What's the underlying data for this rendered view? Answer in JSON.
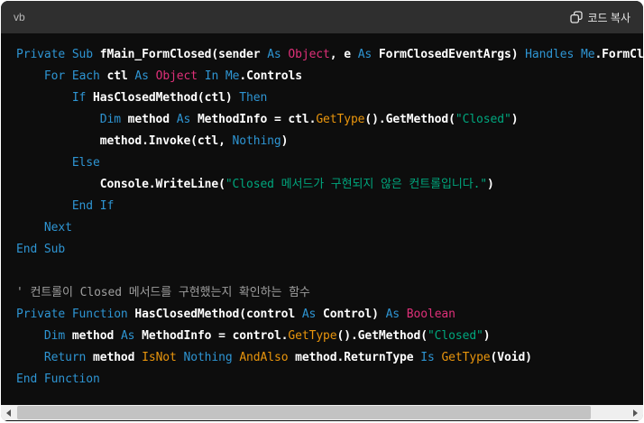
{
  "header": {
    "language": "vb",
    "copy_label": "코드 복사",
    "copy_icon": "copy-icon",
    "background": "#2f2f2f"
  },
  "colors": {
    "k": "#2e95d3",
    "t": "#df3079",
    "s": "#00a67d",
    "o": "#e9950c",
    "c": "#9e9e9e",
    "p": "#ffffff",
    "code_background": "#0d0d0d",
    "page_background": "#ffffff",
    "scrollbar_track": "#efefef",
    "scrollbar_thumb": "#c3c3c3"
  },
  "ui": {
    "icons": {
      "copy": "copy-icon",
      "scroll_left": "triangle-left-icon",
      "scroll_right": "triangle-right-icon"
    }
  },
  "code": {
    "lines": [
      {
        "tokens": [
          [
            "k",
            "Private"
          ],
          [
            "p",
            " "
          ],
          [
            "k",
            "Sub"
          ],
          [
            "p",
            " fMain_FormClosed(sender "
          ],
          [
            "k",
            "As"
          ],
          [
            "p",
            " "
          ],
          [
            "t",
            "Object"
          ],
          [
            "p",
            ", e "
          ],
          [
            "k",
            "As"
          ],
          [
            "p",
            " FormClosedEventArgs) "
          ],
          [
            "k",
            "Handles"
          ],
          [
            "p",
            " "
          ],
          [
            "k",
            "Me"
          ],
          [
            "p",
            ".FormClosed"
          ]
        ]
      },
      {
        "tokens": [
          [
            "p",
            "    "
          ],
          [
            "k",
            "For"
          ],
          [
            "p",
            " "
          ],
          [
            "k",
            "Each"
          ],
          [
            "p",
            " ctl "
          ],
          [
            "k",
            "As"
          ],
          [
            "p",
            " "
          ],
          [
            "t",
            "Object"
          ],
          [
            "p",
            " "
          ],
          [
            "k",
            "In"
          ],
          [
            "p",
            " "
          ],
          [
            "k",
            "Me"
          ],
          [
            "p",
            ".Controls"
          ]
        ]
      },
      {
        "tokens": [
          [
            "p",
            "        "
          ],
          [
            "k",
            "If"
          ],
          [
            "p",
            " HasClosedMethod(ctl) "
          ],
          [
            "k",
            "Then"
          ]
        ]
      },
      {
        "tokens": [
          [
            "p",
            "            "
          ],
          [
            "k",
            "Dim"
          ],
          [
            "p",
            " method "
          ],
          [
            "k",
            "As"
          ],
          [
            "p",
            " MethodInfo = ctl."
          ],
          [
            "o",
            "GetType"
          ],
          [
            "p",
            "().GetMethod("
          ],
          [
            "s",
            "\"Closed\""
          ],
          [
            "p",
            ")"
          ]
        ]
      },
      {
        "tokens": [
          [
            "p",
            "            method.Invoke(ctl, "
          ],
          [
            "k",
            "Nothing"
          ],
          [
            "p",
            ")"
          ]
        ]
      },
      {
        "tokens": [
          [
            "p",
            "        "
          ],
          [
            "k",
            "Else"
          ]
        ]
      },
      {
        "tokens": [
          [
            "p",
            "            Console.WriteLine("
          ],
          [
            "s",
            "\"Closed 메서드가 구현되지 않은 컨트롤입니다.\""
          ],
          [
            "p",
            ")"
          ]
        ]
      },
      {
        "tokens": [
          [
            "p",
            "        "
          ],
          [
            "k",
            "End If"
          ]
        ]
      },
      {
        "tokens": [
          [
            "p",
            "    "
          ],
          [
            "k",
            "Next"
          ]
        ]
      },
      {
        "tokens": [
          [
            "k",
            "End Sub"
          ]
        ]
      },
      {
        "tokens": []
      },
      {
        "tokens": [
          [
            "c",
            "' 컨트롤이 Closed 메서드를 구현했는지 확인하는 함수"
          ]
        ]
      },
      {
        "tokens": [
          [
            "k",
            "Private"
          ],
          [
            "p",
            " "
          ],
          [
            "k",
            "Function"
          ],
          [
            "p",
            " HasClosedMethod(control "
          ],
          [
            "k",
            "As"
          ],
          [
            "p",
            " Control) "
          ],
          [
            "k",
            "As"
          ],
          [
            "p",
            " "
          ],
          [
            "t",
            "Boolean"
          ]
        ]
      },
      {
        "tokens": [
          [
            "p",
            "    "
          ],
          [
            "k",
            "Dim"
          ],
          [
            "p",
            " method "
          ],
          [
            "k",
            "As"
          ],
          [
            "p",
            " MethodInfo = control."
          ],
          [
            "o",
            "GetType"
          ],
          [
            "p",
            "().GetMethod("
          ],
          [
            "s",
            "\"Closed\""
          ],
          [
            "p",
            ")"
          ]
        ]
      },
      {
        "tokens": [
          [
            "p",
            "    "
          ],
          [
            "k",
            "Return"
          ],
          [
            "p",
            " method "
          ],
          [
            "o",
            "IsNot"
          ],
          [
            "p",
            " "
          ],
          [
            "k",
            "Nothing"
          ],
          [
            "p",
            " "
          ],
          [
            "o",
            "AndAlso"
          ],
          [
            "p",
            " method.ReturnType "
          ],
          [
            "k",
            "Is"
          ],
          [
            "p",
            " "
          ],
          [
            "o",
            "GetType"
          ],
          [
            "p",
            "(Void)"
          ]
        ]
      },
      {
        "tokens": [
          [
            "k",
            "End Function"
          ]
        ]
      }
    ]
  }
}
